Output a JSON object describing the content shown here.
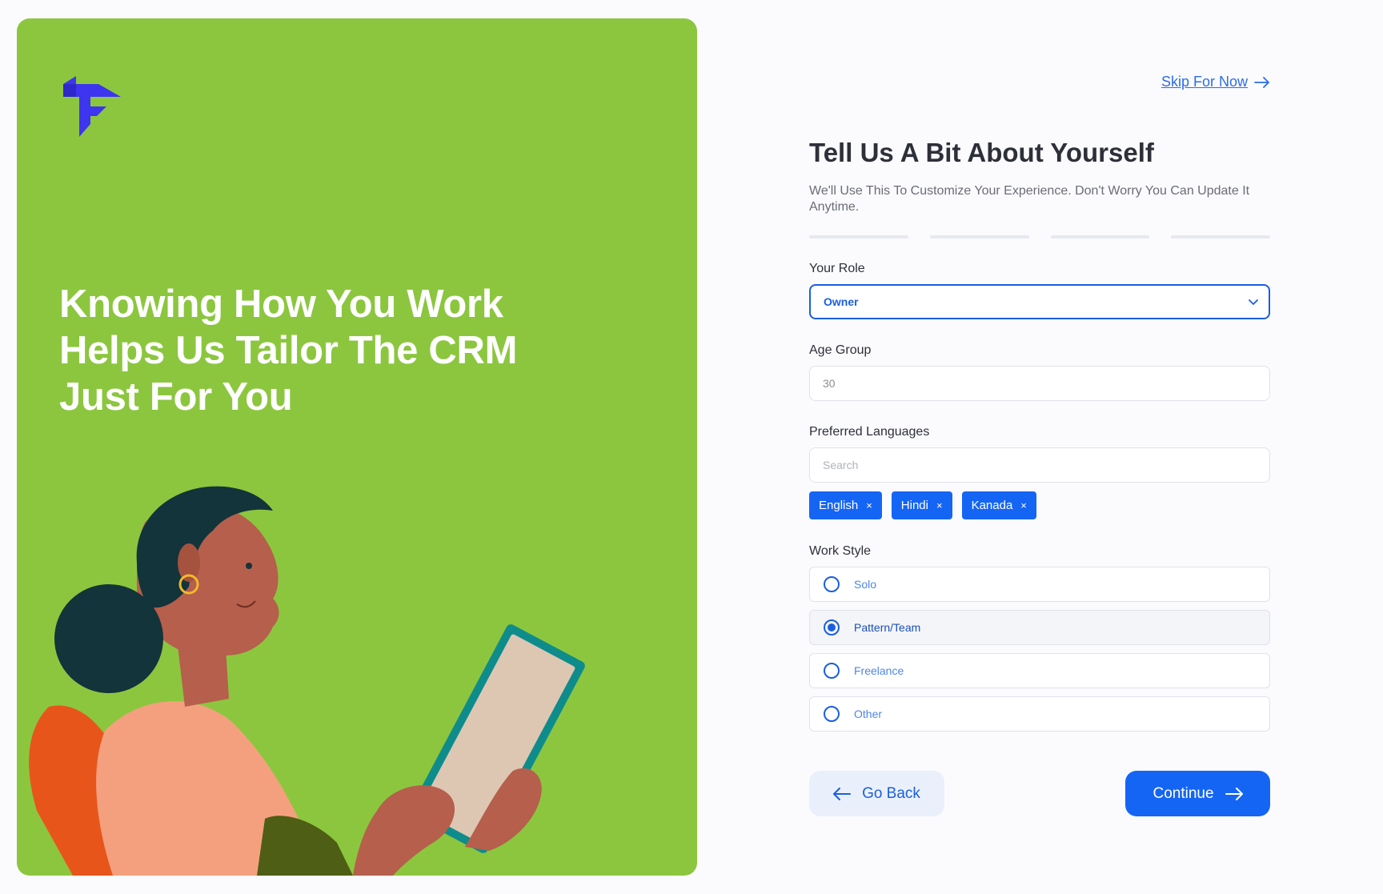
{
  "colors": {
    "accent": "#1565f5",
    "hero_bg": "#8cc63f",
    "logo": "#3d35f0"
  },
  "hero": {
    "logo_icon": "brand-logo-icon",
    "title": "Knowing How You Work Helps Us Tailor The CRM Just For You"
  },
  "header": {
    "skip_label": "Skip For Now",
    "skip_icon": "arrow-right-icon"
  },
  "form": {
    "title": "Tell Us A Bit About Yourself",
    "subtitle": "We'll Use This To Customize Your Experience. Don't Worry You Can Update It Anytime.",
    "progress_steps": 4,
    "role": {
      "label": "Your Role",
      "value": "Owner",
      "icon": "chevron-down-icon"
    },
    "age_group": {
      "label": "Age Group",
      "value": "30"
    },
    "languages": {
      "label": "Preferred Languages",
      "placeholder": "Search",
      "selected": [
        "English",
        "Hindi",
        "Kanada"
      ],
      "remove_glyph": "×"
    },
    "work_style": {
      "label": "Work Style",
      "options": [
        "Solo",
        "Pattern/Team",
        "Freelance",
        "Other"
      ],
      "selected": "Pattern/Team"
    }
  },
  "actions": {
    "back_label": "Go Back",
    "back_icon": "arrow-left-icon",
    "continue_label": "Continue",
    "continue_icon": "arrow-right-icon"
  }
}
